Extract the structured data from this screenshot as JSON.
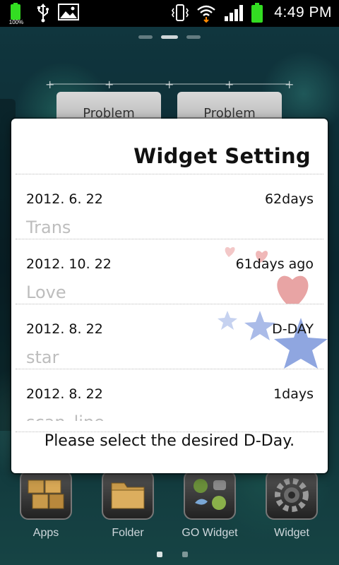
{
  "status_bar": {
    "battery_small_pct": "100%",
    "time": "4:49 PM"
  },
  "home": {
    "problem_cards": [
      "Problem",
      "Problem"
    ],
    "dock": [
      {
        "label": "Apps",
        "icon": "apps-box-icon"
      },
      {
        "label": "Folder",
        "icon": "folder-icon"
      },
      {
        "label": "GO Widget",
        "icon": "go-widget-icon"
      },
      {
        "label": "Widget",
        "icon": "widget-gear-icon"
      }
    ]
  },
  "dialog": {
    "title": "Widget Setting",
    "items": [
      {
        "date": "2012. 6. 22",
        "count": "62days",
        "name": "Trans"
      },
      {
        "date": "2012. 10. 22",
        "count": "61days ago",
        "name": "Love"
      },
      {
        "date": "2012. 8. 22",
        "count": "D-DAY",
        "name": "star"
      },
      {
        "date": "2012. 8. 22",
        "count": "1days",
        "name": "scan_line"
      }
    ],
    "footer": "Please select the desired D-Day."
  },
  "colors": {
    "battery_green": "#33dd22",
    "heart_pink": "#e8a4a4",
    "star_blue": "#8fa6e0"
  }
}
